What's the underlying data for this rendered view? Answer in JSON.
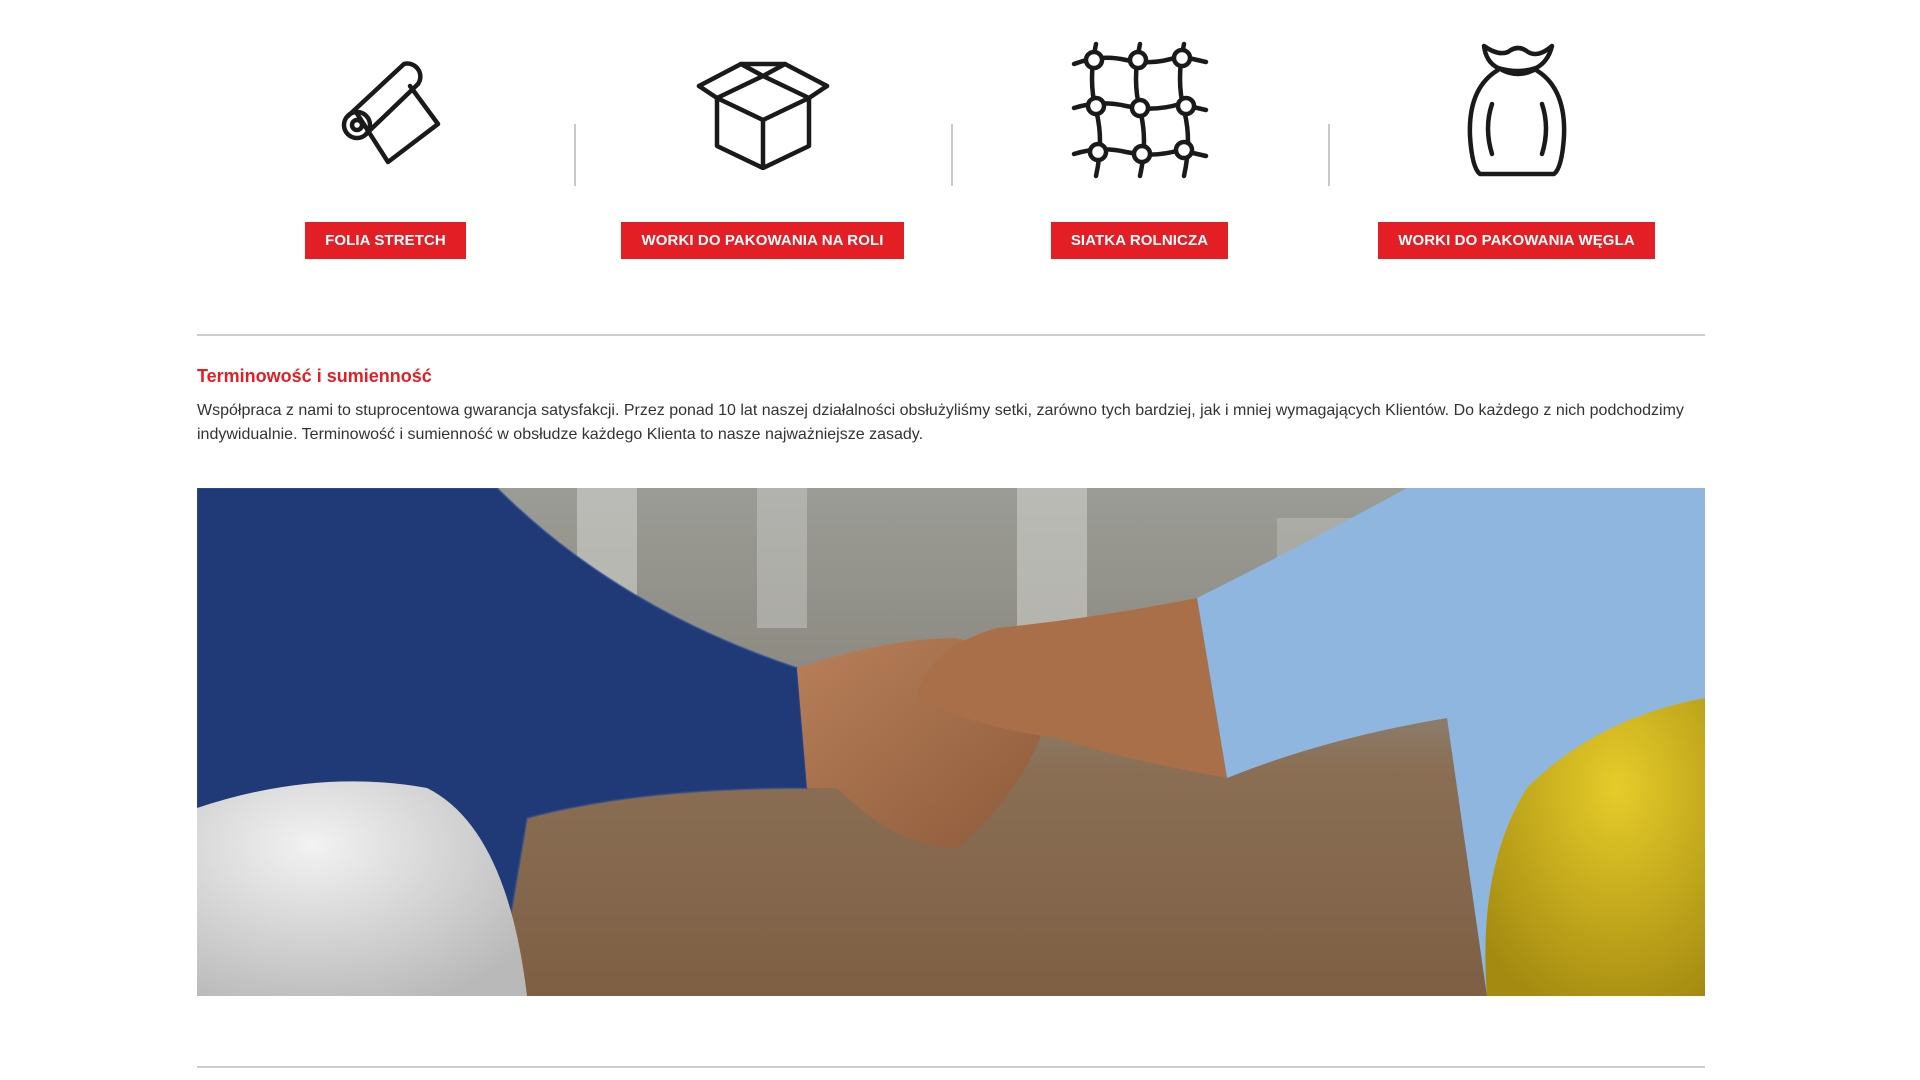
{
  "products": [
    {
      "icon": "stretch-film-roll-icon",
      "button_label": "FOLIA STRETCH"
    },
    {
      "icon": "open-box-icon",
      "button_label": "WORKI DO PAKOWANIA NA ROLI"
    },
    {
      "icon": "net-mesh-icon",
      "button_label": "SIATKA ROLNICZA"
    },
    {
      "icon": "sack-bag-icon",
      "button_label": "WORKI DO PAKOWANIA WĘGLA"
    }
  ],
  "section": {
    "title": "Terminowość i sumienność",
    "text": "Współpraca z nami to stuprocentowa gwarancja satysfakcji. Przez ponad 10 lat naszej działalności obsłużyliśmy setki, zarówno tych bardziej, jak i mniej wymagających Klientów. Do każdego z nich podchodzimy indywidualnie. Terminowość i sumienność w obsłudze każdego Klienta to nasze najważniejsze zasady."
  },
  "colors": {
    "accent": "#e31e24",
    "divider": "#cfcfcf",
    "icon_stroke": "#1a1a1a"
  }
}
